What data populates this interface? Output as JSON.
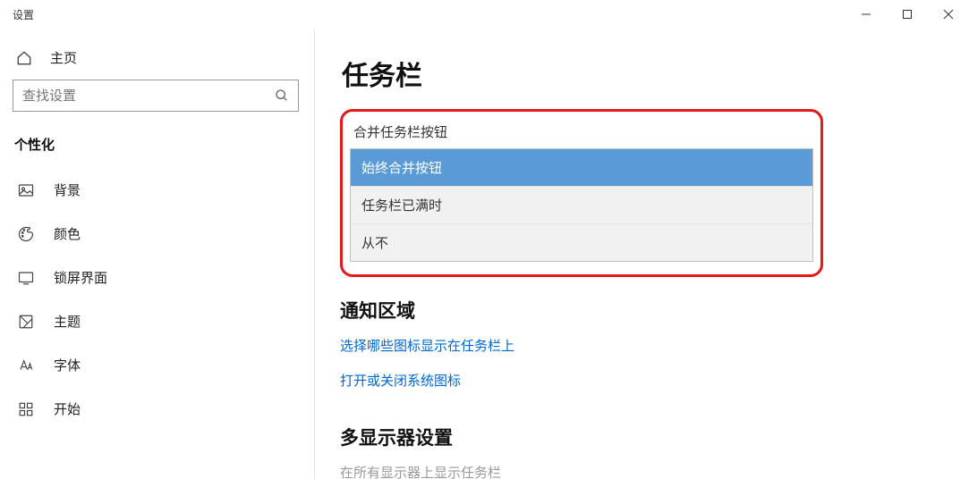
{
  "window": {
    "title": "设置"
  },
  "sidebar": {
    "home": "主页",
    "search_placeholder": "查找设置",
    "section": "个性化",
    "items": [
      {
        "label": "背景"
      },
      {
        "label": "颜色"
      },
      {
        "label": "锁屏界面"
      },
      {
        "label": "主题"
      },
      {
        "label": "字体"
      },
      {
        "label": "开始"
      }
    ]
  },
  "content": {
    "title": "任务栏",
    "combine_label": "合并任务栏按钮",
    "options": [
      "始终合并按钮",
      "任务栏已满时",
      "从不"
    ],
    "section_notification": "通知区域",
    "link_icons": "选择哪些图标显示在任务栏上",
    "link_system_icons": "打开或关闭系统图标",
    "section_multidisplay": "多显示器设置",
    "multidisplay_sub": "在所有显示器上显示任务栏"
  }
}
